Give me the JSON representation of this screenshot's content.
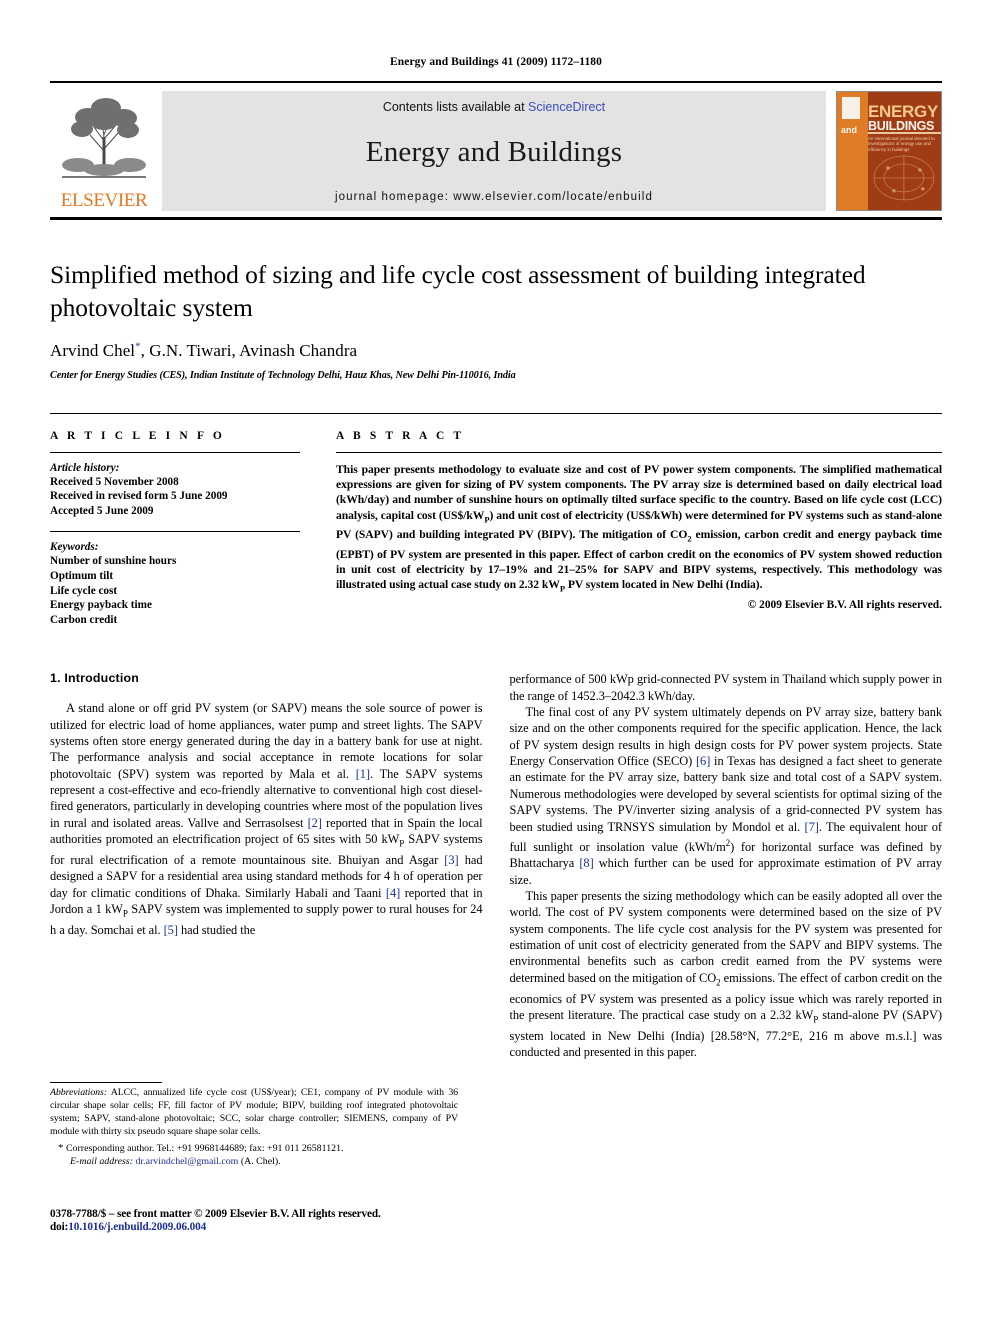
{
  "running_head": "Energy and Buildings 41 (2009) 1172–1180",
  "masthead": {
    "publisher_name": "ELSEVIER",
    "contents_prefix": "Contents lists available at ",
    "sciencedirect": "ScienceDirect",
    "journal_name": "Energy and Buildings",
    "homepage": "journal homepage: www.elsevier.com/locate/enbuild",
    "cover": {
      "and": "and",
      "energy": "ENERGY",
      "buildings": "BUILDINGS",
      "subtitle": "An international journal devoted to investigations of energy use and efficiency in buildings"
    }
  },
  "article": {
    "title": "Simplified method of sizing and life cycle cost assessment of building integrated photovoltaic system",
    "authors": "Arvind Chel, G.N. Tiwari, Avinash Chandra",
    "author_marker": "*",
    "affiliation": "Center for Energy Studies (CES), Indian Institute of Technology Delhi, Hauz Khas, New Delhi Pin-110016, India"
  },
  "info": {
    "heading": "A R T I C L E    I N F O",
    "history_label": "Article history:",
    "history": [
      "Received 5 November 2008",
      "Received in revised form 5 June 2009",
      "Accepted 5 June 2009"
    ],
    "keywords_label": "Keywords:",
    "keywords": [
      "Number of sunshine hours",
      "Optimum tilt",
      "Life cycle cost",
      "Energy payback time",
      "Carbon credit"
    ]
  },
  "abstract": {
    "heading": "A B S T R A C T",
    "text_part1": "This paper presents methodology to evaluate size and cost of PV power system components. The simplified mathematical expressions are given for sizing of PV system components. The PV array size is determined based on daily electrical load (kWh/day) and number of sunshine hours on optimally tilted surface specific to the country. Based on life cycle cost (LCC) analysis, capital cost (US$/kW",
    "sub1": "P",
    "text_part2": ") and unit cost of electricity (US$/kWh) were determined for PV systems such as stand-alone PV (SAPV) and building integrated PV (BIPV). The mitigation of CO",
    "sub2": "2",
    "text_part3": " emission, carbon credit and energy payback time (EPBT) of PV system are presented in this paper. Effect of carbon credit on the economics of PV system showed reduction in unit cost of electricity by 17–19% and 21–25% for SAPV and BIPV systems, respectively. This methodology was illustrated using actual case study on 2.32 kW",
    "sub3": "P",
    "text_part4": " PV system located in New Delhi (India).",
    "copyright": "© 2009 Elsevier B.V. All rights reserved."
  },
  "body": {
    "section_title": "1. Introduction",
    "left": {
      "p1_a": "A stand alone or off grid PV system (or SAPV) means the sole source of power is utilized for electric load of home appliances, water pump and street lights. The SAPV systems often store energy generated during the day in a battery bank for use at night. The performance analysis and social acceptance in remote locations for solar photovoltaic (SPV) system was reported by Mala et al. ",
      "ref1": "[1]",
      "p1_b": ". The SAPV systems represent a cost-effective and eco-friendly alternative to conventional high cost diesel-fired generators, particularly in developing countries where most of the population lives in rural and isolated areas. Vallve and Serrasolsest ",
      "ref2": "[2]",
      "p1_c": " reported that in Spain the local authorities promoted an electrification project of 65 sites with 50 kW",
      "sub_p": "P",
      "p1_d": " SAPV systems for rural electrification of a remote mountainous site. Bhuiyan and Asgar ",
      "ref3": "[3]",
      "p1_e": " had designed a SAPV for a residential area using standard methods for 4 h of operation per day for climatic conditions of Dhaka. Similarly Habali and Taani ",
      "ref4": "[4]",
      "p1_f": " reported that in Jordon a 1 kW",
      "sub_p2": "P",
      "p1_g": " SAPV system was implemented to supply power to rural houses for 24 h a day. Somchai et al. ",
      "ref5": "[5]",
      "p1_h": " had studied the"
    },
    "right": {
      "p1_cont": "performance of 500 kWp grid-connected PV system in Thailand which supply power in the range of 1452.3–2042.3 kWh/day.",
      "p2_a": "The final cost of any PV system ultimately depends on PV array size, battery bank size and on the other components required for the specific application. Hence, the lack of PV system design results in high design costs for PV power system projects. State Energy Conservation Office (SECO) ",
      "ref6": "[6]",
      "p2_b": " in Texas has designed a fact sheet to generate an estimate for the PV array size, battery bank size and total cost of a SAPV system. Numerous methodologies were developed by several scientists for optimal sizing of the SAPV systems. The PV/inverter sizing analysis of a grid-connected PV system has been studied using TRNSYS simulation by Mondol et al. ",
      "ref7": "[7]",
      "p2_c": ". The equivalent hour of full sunlight or insolation value (kWh/m",
      "sup2": "2",
      "p2_d": ") for horizontal surface was defined by Bhattacharya ",
      "ref8": "[8]",
      "p2_e": " which further can be used for approximate estimation of PV array size.",
      "p3_a": "This paper presents the sizing methodology which can be easily adopted all over the world. The cost of PV system components were determined based on the size of PV system components. The life cycle cost analysis for the PV system was presented for estimation of unit cost of electricity generated from the SAPV and BIPV systems. The environmental benefits such as carbon credit earned from the PV systems were determined based on the mitigation of CO",
      "sub2": "2",
      "p3_b": " emissions. The effect of carbon credit on the economics of PV system was presented as a policy issue which was rarely reported in the present literature. The practical case study on a 2.32 kW",
      "sub_p": "P",
      "p3_c": " stand-alone PV (SAPV) system located in New Delhi (India) [28.58°N, 77.2°E, 216 m above m.s.l.] was conducted and presented in this paper."
    }
  },
  "footnotes": {
    "abbrev_label": "Abbreviations:",
    "abbrev_text": " ALCC, annualized life cycle cost (US$/year); CE1, company of PV module with 36 circular shape solar cells; FF, fill factor of PV module; BIPV, building roof integrated photovoltaic system; SAPV, stand-alone photovoltaic; SCC, solar charge controller; SIEMENS, company of PV module with thirty six pseudo square shape solar cells.",
    "corresponding": "Corresponding author. Tel.: +91 9968144689; fax: +91 011 26581121.",
    "email_label": "E-mail address:",
    "email": "dr.arvindchel@gmail.com",
    "email_suffix": " (A. Chel)."
  },
  "footer": {
    "issn_line": "0378-7788/$ – see front matter © 2009 Elsevier B.V. All rights reserved.",
    "doi_label": "doi:",
    "doi": "10.1016/j.enbuild.2009.06.004"
  }
}
